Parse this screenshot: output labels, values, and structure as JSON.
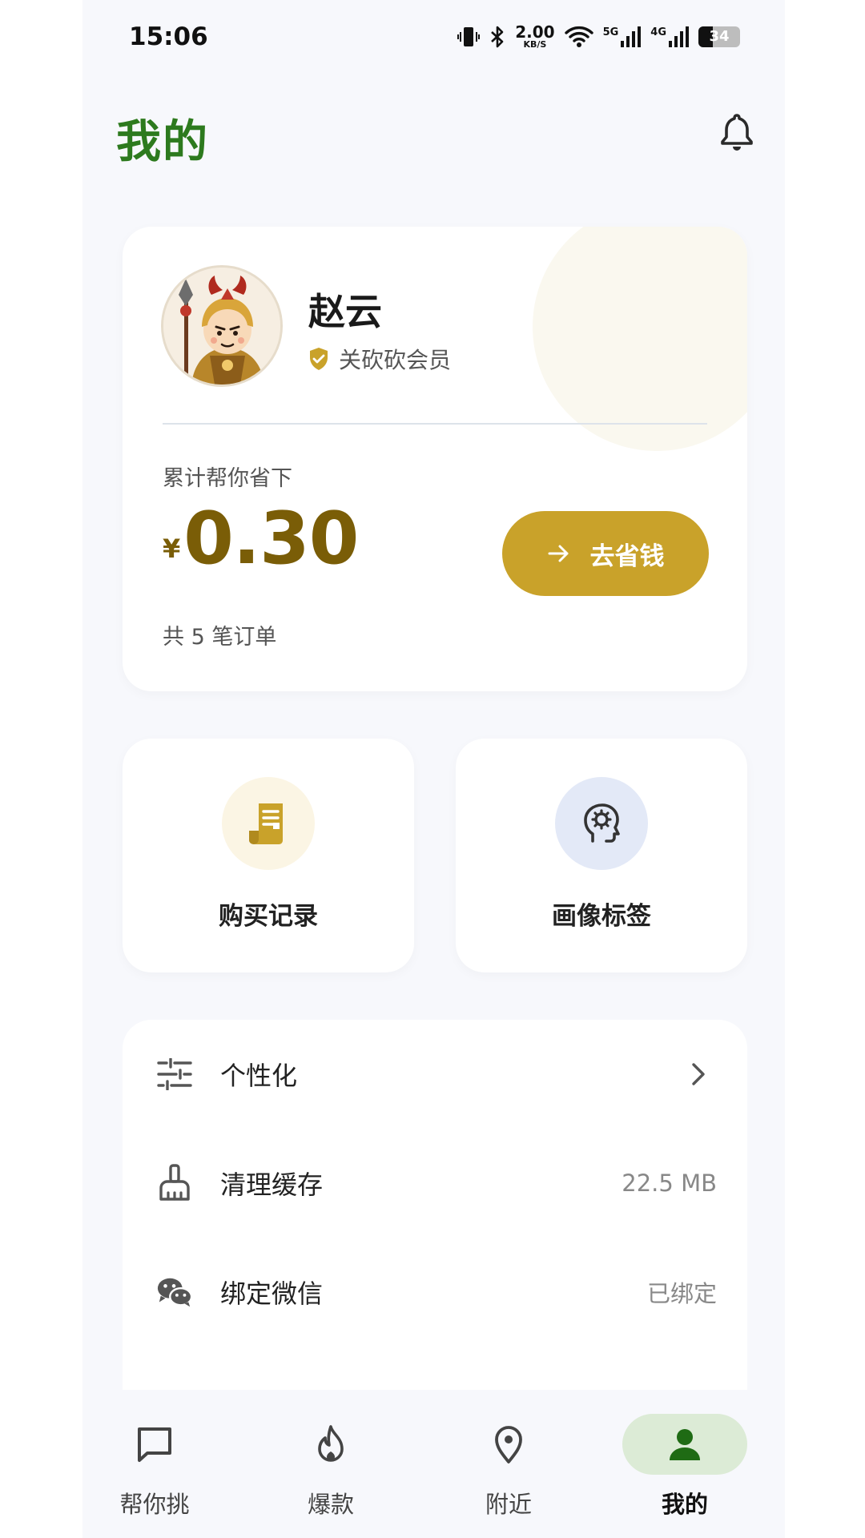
{
  "status_bar": {
    "time": "15:06",
    "speed_value": "2.00",
    "speed_unit": "KB/S",
    "net_5g": "5G",
    "net_4g": "4G",
    "battery": "34",
    "battery_level": 0.34
  },
  "header": {
    "title": "我的",
    "notification_icon": "bell-icon"
  },
  "profile": {
    "name": "赵云",
    "member_label": "关砍砍会员",
    "saved_label": "累计帮你省下",
    "currency": "¥",
    "amount": "0.30",
    "orders_text": "共 5 笔订单",
    "go_button_label": "去省钱"
  },
  "quick_actions": [
    {
      "label": "购买记录",
      "icon": "receipt-icon"
    },
    {
      "label": "画像标签",
      "icon": "head-gear-icon"
    }
  ],
  "settings": [
    {
      "label": "个性化",
      "icon": "sliders-icon",
      "value": ""
    },
    {
      "label": "清理缓存",
      "icon": "broom-icon",
      "value": "22.5 MB"
    },
    {
      "label": "绑定微信",
      "icon": "wechat-icon",
      "value": "已绑定"
    }
  ],
  "bottom_nav": [
    {
      "label": "帮你挑",
      "icon": "chat-icon",
      "active": false
    },
    {
      "label": "爆款",
      "icon": "flame-icon",
      "active": false
    },
    {
      "label": "附近",
      "icon": "location-pin-icon",
      "active": false
    },
    {
      "label": "我的",
      "icon": "person-icon",
      "active": true
    }
  ],
  "colors": {
    "title_green": "#2d7a1e",
    "gold": "#c9a22a",
    "amount_brown": "#7a5d07",
    "active_pill": "#dcebd6"
  }
}
